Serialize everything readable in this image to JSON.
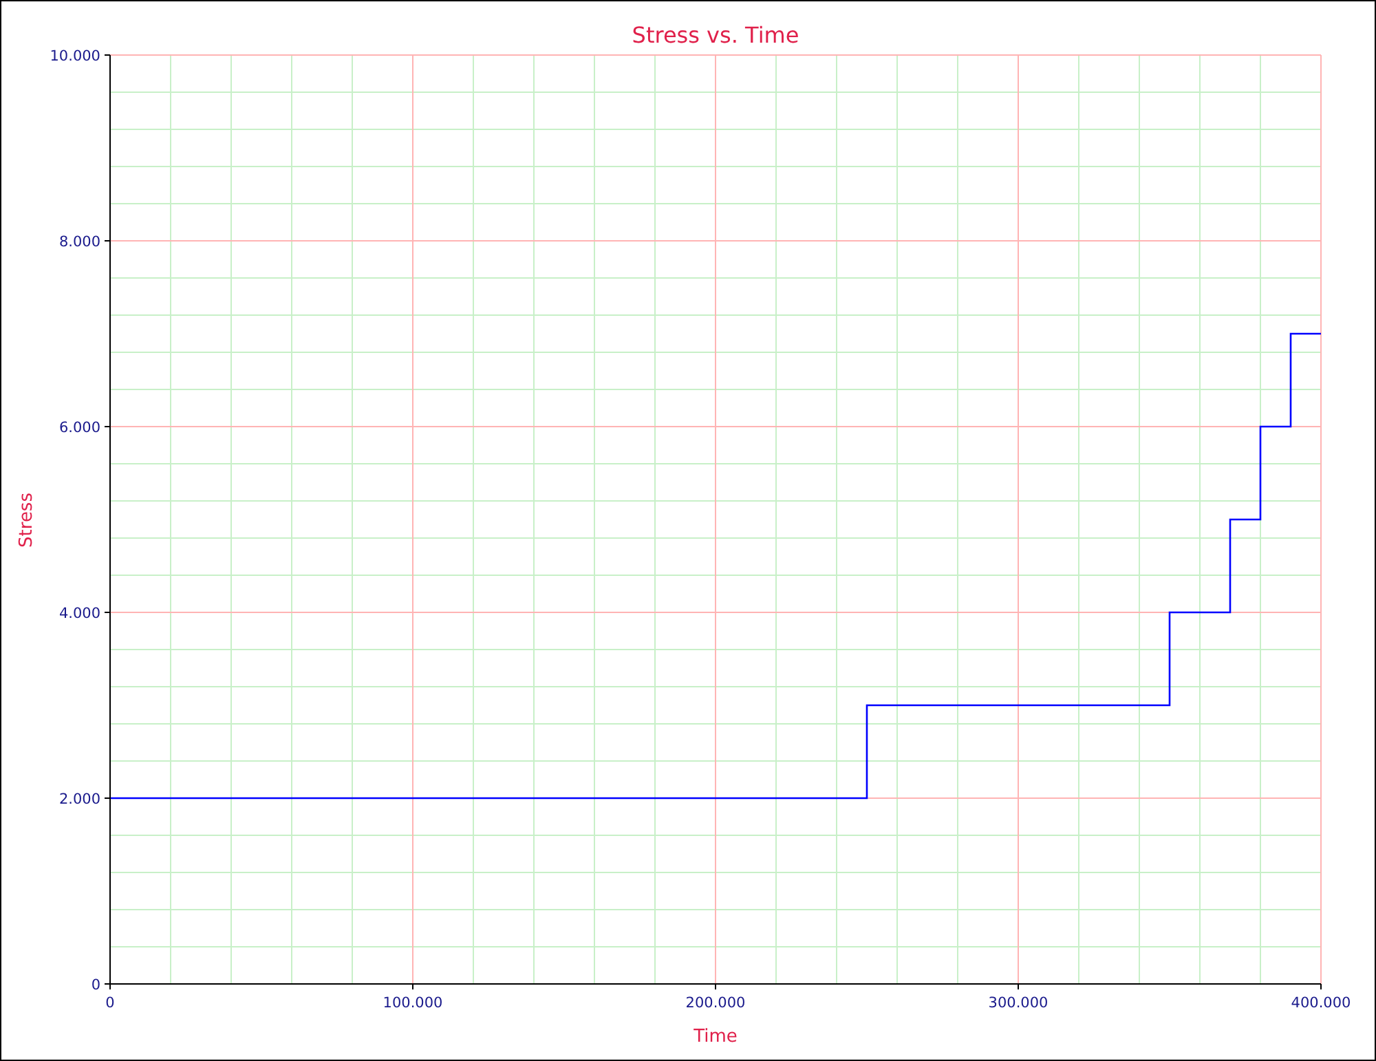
{
  "chart": {
    "chart_data": {
      "type": "line",
      "grid": true,
      "title": "Stress vs. Time",
      "xlabel": "Time",
      "ylabel": "Stress",
      "x": [
        0,
        250000,
        250000,
        350000,
        350000,
        370000,
        370000,
        380000,
        380000,
        390000,
        390000,
        400000
      ],
      "series": [
        {
          "color": "#0000ff",
          "values": [
            2000,
            2000,
            3000,
            3000,
            4000,
            4000,
            5000,
            5000,
            6000,
            6000,
            7000,
            7000
          ]
        }
      ],
      "xlim": [
        0,
        400000
      ],
      "ylim": [
        0,
        10000
      ],
      "xticks": [
        {
          "value": 0,
          "label": "0"
        },
        {
          "value": 100000,
          "label": "100.000"
        },
        {
          "value": 200000,
          "label": "200.000"
        },
        {
          "value": 300000,
          "label": "300.000"
        },
        {
          "value": 400000,
          "label": "400.000"
        }
      ],
      "yticks": [
        {
          "value": 0,
          "label": "0"
        },
        {
          "value": 2000,
          "label": "2.000"
        },
        {
          "value": 4000,
          "label": "4.000"
        },
        {
          "value": 6000,
          "label": "6.000"
        },
        {
          "value": 8000,
          "label": "8.000"
        },
        {
          "value": 10000,
          "label": "10.000"
        }
      ]
    }
  }
}
